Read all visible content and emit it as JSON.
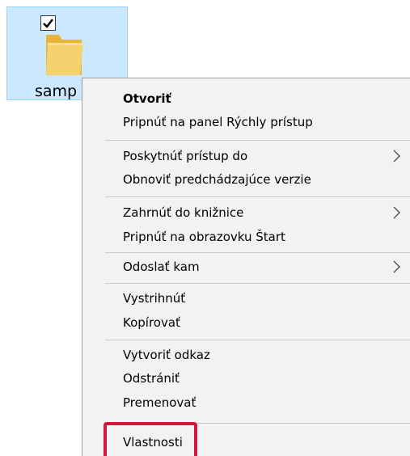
{
  "desktop": {
    "folder": {
      "label": "samp",
      "checked": true,
      "icon": "folder-icon",
      "checkbox_icon": "checkmark-icon"
    }
  },
  "context_menu": {
    "groups": [
      [
        {
          "label": "Otvoriť",
          "bold": true,
          "submenu": false
        },
        {
          "label": "Pripnúť na panel Rýchly prístup",
          "bold": false,
          "submenu": false
        }
      ],
      [
        {
          "label": "Poskytnúť prístup do",
          "bold": false,
          "submenu": true
        },
        {
          "label": "Obnoviť predchádzajúce verzie",
          "bold": false,
          "submenu": false
        }
      ],
      [
        {
          "label": "Zahrnúť do knižnice",
          "bold": false,
          "submenu": true
        },
        {
          "label": "Pripnúť na obrazovku Štart",
          "bold": false,
          "submenu": false
        }
      ],
      [
        {
          "label": "Odoslať kam",
          "bold": false,
          "submenu": true
        }
      ],
      [
        {
          "label": "Vystrihnúť",
          "bold": false,
          "submenu": false
        },
        {
          "label": "Kopírovať",
          "bold": false,
          "submenu": false
        }
      ],
      [
        {
          "label": "Vytvoriť odkaz",
          "bold": false,
          "submenu": false
        },
        {
          "label": "Odstrániť",
          "bold": false,
          "submenu": false
        },
        {
          "label": "Premenovať",
          "bold": false,
          "submenu": false
        }
      ],
      [
        {
          "label": "Vlastnosti",
          "bold": false,
          "submenu": false,
          "highlighted": true
        }
      ]
    ],
    "submenu_icon": "chevron-right-icon"
  },
  "colors": {
    "selection_bg": "#cce8ff",
    "menu_bg": "#f2f2f2",
    "highlight_border": "#d4143a"
  }
}
